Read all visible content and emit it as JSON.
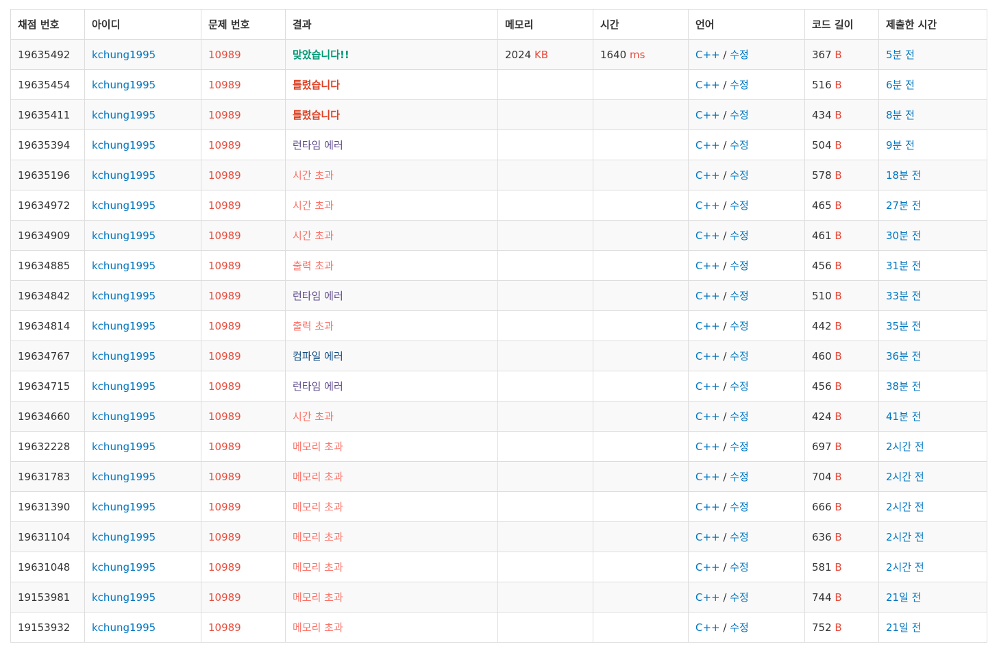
{
  "headers": [
    "채점 번호",
    "아이디",
    "문제 번호",
    "결과",
    "메모리",
    "시간",
    "언어",
    "코드 길이",
    "제출한 시간"
  ],
  "colors": {
    "link": "#0076c0",
    "problem": "#e74c3c",
    "accepted": "#009874",
    "wrong": "#dd4124",
    "limit": "#fa7268",
    "runtime": "#5f4b8b",
    "compile": "#0f4c81"
  },
  "units": {
    "memory": "KB",
    "time": "ms",
    "length": "B"
  },
  "lang": {
    "name": "C++",
    "sep": " / ",
    "edit": "수정"
  },
  "rows": [
    {
      "id": "19635492",
      "user": "kchung1995",
      "problem": "10989",
      "result": "맞았습니다!!",
      "result_type": "ac",
      "memory": "2024",
      "time": "1640",
      "length": "367",
      "submitted": "5분 전"
    },
    {
      "id": "19635454",
      "user": "kchung1995",
      "problem": "10989",
      "result": "틀렸습니다",
      "result_type": "wa",
      "memory": "",
      "time": "",
      "length": "516",
      "submitted": "6분 전"
    },
    {
      "id": "19635411",
      "user": "kchung1995",
      "problem": "10989",
      "result": "틀렸습니다",
      "result_type": "wa",
      "memory": "",
      "time": "",
      "length": "434",
      "submitted": "8분 전"
    },
    {
      "id": "19635394",
      "user": "kchung1995",
      "problem": "10989",
      "result": "런타임 에러",
      "result_type": "rte",
      "memory": "",
      "time": "",
      "length": "504",
      "submitted": "9분 전"
    },
    {
      "id": "19635196",
      "user": "kchung1995",
      "problem": "10989",
      "result": "시간 초과",
      "result_type": "tle",
      "memory": "",
      "time": "",
      "length": "578",
      "submitted": "18분 전"
    },
    {
      "id": "19634972",
      "user": "kchung1995",
      "problem": "10989",
      "result": "시간 초과",
      "result_type": "tle",
      "memory": "",
      "time": "",
      "length": "465",
      "submitted": "27분 전"
    },
    {
      "id": "19634909",
      "user": "kchung1995",
      "problem": "10989",
      "result": "시간 초과",
      "result_type": "tle",
      "memory": "",
      "time": "",
      "length": "461",
      "submitted": "30분 전"
    },
    {
      "id": "19634885",
      "user": "kchung1995",
      "problem": "10989",
      "result": "출력 초과",
      "result_type": "ole",
      "memory": "",
      "time": "",
      "length": "456",
      "submitted": "31분 전"
    },
    {
      "id": "19634842",
      "user": "kchung1995",
      "problem": "10989",
      "result": "런타임 에러",
      "result_type": "rte",
      "memory": "",
      "time": "",
      "length": "510",
      "submitted": "33분 전"
    },
    {
      "id": "19634814",
      "user": "kchung1995",
      "problem": "10989",
      "result": "출력 초과",
      "result_type": "ole",
      "memory": "",
      "time": "",
      "length": "442",
      "submitted": "35분 전"
    },
    {
      "id": "19634767",
      "user": "kchung1995",
      "problem": "10989",
      "result": "컴파일 에러",
      "result_type": "ce",
      "memory": "",
      "time": "",
      "length": "460",
      "submitted": "36분 전"
    },
    {
      "id": "19634715",
      "user": "kchung1995",
      "problem": "10989",
      "result": "런타임 에러",
      "result_type": "rte",
      "memory": "",
      "time": "",
      "length": "456",
      "submitted": "38분 전"
    },
    {
      "id": "19634660",
      "user": "kchung1995",
      "problem": "10989",
      "result": "시간 초과",
      "result_type": "tle",
      "memory": "",
      "time": "",
      "length": "424",
      "submitted": "41분 전"
    },
    {
      "id": "19632228",
      "user": "kchung1995",
      "problem": "10989",
      "result": "메모리 초과",
      "result_type": "mle",
      "memory": "",
      "time": "",
      "length": "697",
      "submitted": "2시간 전"
    },
    {
      "id": "19631783",
      "user": "kchung1995",
      "problem": "10989",
      "result": "메모리 초과",
      "result_type": "mle",
      "memory": "",
      "time": "",
      "length": "704",
      "submitted": "2시간 전"
    },
    {
      "id": "19631390",
      "user": "kchung1995",
      "problem": "10989",
      "result": "메모리 초과",
      "result_type": "mle",
      "memory": "",
      "time": "",
      "length": "666",
      "submitted": "2시간 전"
    },
    {
      "id": "19631104",
      "user": "kchung1995",
      "problem": "10989",
      "result": "메모리 초과",
      "result_type": "mle",
      "memory": "",
      "time": "",
      "length": "636",
      "submitted": "2시간 전"
    },
    {
      "id": "19631048",
      "user": "kchung1995",
      "problem": "10989",
      "result": "메모리 초과",
      "result_type": "mle",
      "memory": "",
      "time": "",
      "length": "581",
      "submitted": "2시간 전"
    },
    {
      "id": "19153981",
      "user": "kchung1995",
      "problem": "10989",
      "result": "메모리 초과",
      "result_type": "mle",
      "memory": "",
      "time": "",
      "length": "744",
      "submitted": "21일 전"
    },
    {
      "id": "19153932",
      "user": "kchung1995",
      "problem": "10989",
      "result": "메모리 초과",
      "result_type": "mle",
      "memory": "",
      "time": "",
      "length": "752",
      "submitted": "21일 전"
    }
  ]
}
